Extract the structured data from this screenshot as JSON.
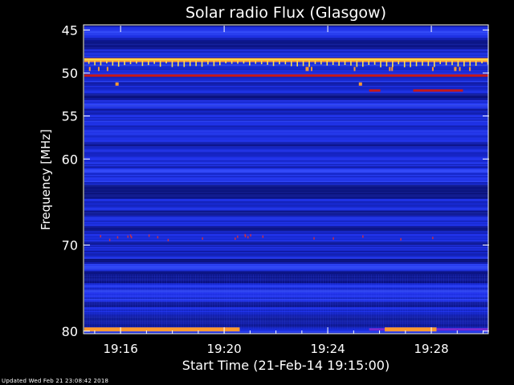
{
  "chart_data": {
    "type": "heatmap",
    "title": "Solar radio Flux (Glasgow)",
    "xlabel": "Start Time (21-Feb-14 19:15:00)",
    "ylabel": "Frequency [MHz]",
    "x_ticks": [
      "19:16",
      "19:20",
      "19:24",
      "19:28"
    ],
    "x_tick_minutes": [
      1,
      5,
      9,
      13
    ],
    "x_range_minutes": [
      -0.4,
      15.2
    ],
    "y_ticks": [
      45,
      50,
      55,
      60,
      70,
      80
    ],
    "y_range": [
      44.5,
      80.3
    ],
    "colors": {
      "background": "#000000",
      "base": "#1a2ee0",
      "dark": "#0a0d7a",
      "mid": "#2a3af5",
      "bright": "#3a52ff",
      "hot": "#ff9a30",
      "hot_core": "#ffe04a",
      "red": "#c81818"
    }
  },
  "footer": {
    "updated": "Updated Wed Feb 21 23:08:42 2018"
  }
}
